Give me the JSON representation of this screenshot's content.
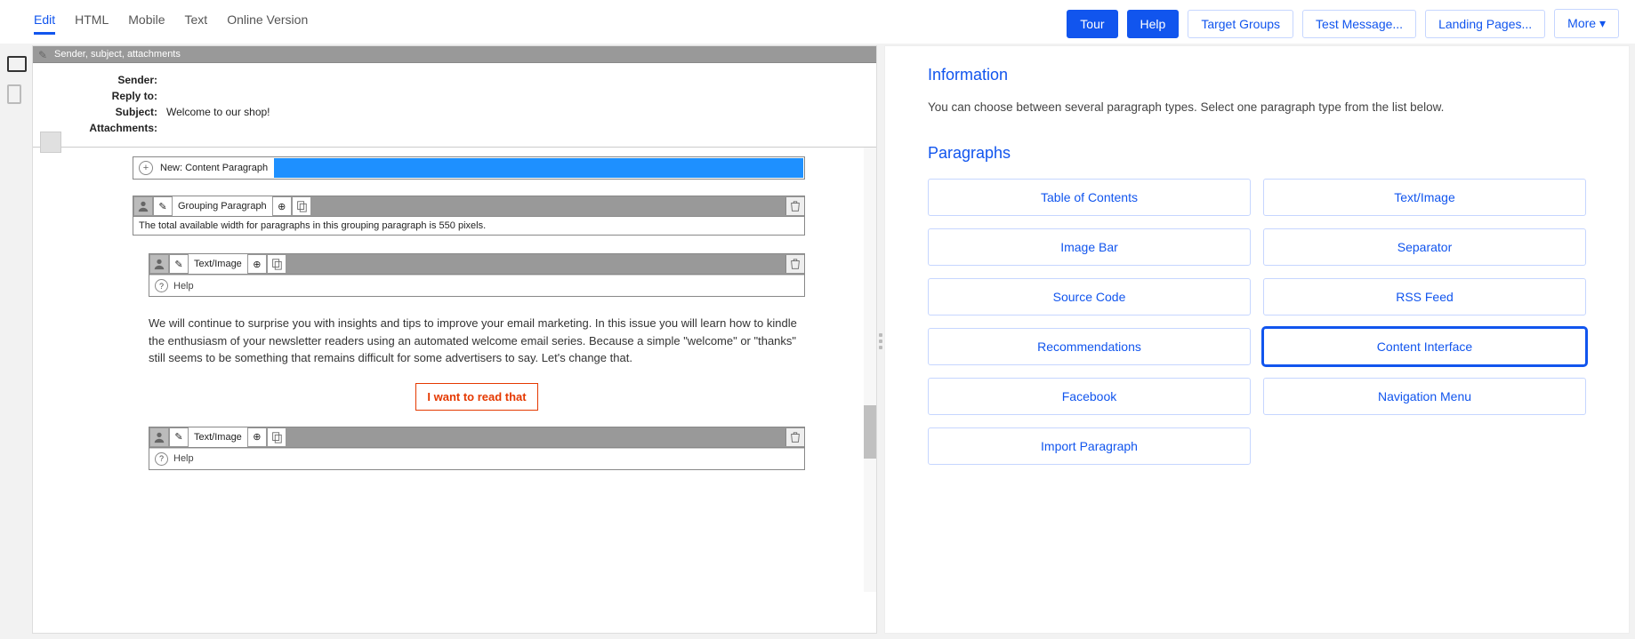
{
  "tabs": {
    "edit": "Edit",
    "html": "HTML",
    "mobile": "Mobile",
    "text": "Text",
    "online": "Online Version"
  },
  "top_buttons": {
    "tour": "Tour",
    "help": "Help",
    "target": "Target Groups",
    "test": "Test Message...",
    "landing": "Landing Pages...",
    "more": "More"
  },
  "header_bar": "Sender, subject, attachments",
  "meta": {
    "sender": "Sender:",
    "replyto": "Reply to:",
    "subject_l": "Subject:",
    "subject_v": "Welcome to our shop!",
    "attach": "Attachments:"
  },
  "new_para": "New: Content Paragraph",
  "grouping": {
    "title": "Grouping Paragraph",
    "note": "The total available width for paragraphs in this grouping paragraph is 550 pixels."
  },
  "ti": {
    "title": "Text/Image",
    "help": "Help"
  },
  "body": "We will continue to surprise you with insights and tips to improve your email marketing. In this issue you will learn how to kindle the enthusiasm of your newsletter readers using an automated welcome email series. Because a simple \"welcome\" or \"thanks\" still seems to be something that remains difficult for some advertisers to say. Let's change that.",
  "cta": "I want to read that",
  "info": {
    "h": "Information",
    "p": "You can choose between several paragraph types. Select one paragraph type from the list below.",
    "h2": "Paragraphs"
  },
  "ptypes": {
    "toc": "Table of Contents",
    "ti": "Text/Image",
    "imgbar": "Image Bar",
    "sep": "Separator",
    "src": "Source Code",
    "rss": "RSS Feed",
    "rec": "Recommendations",
    "ci": "Content Interface",
    "fb": "Facebook",
    "nav": "Navigation Menu",
    "import": "Import Paragraph"
  }
}
